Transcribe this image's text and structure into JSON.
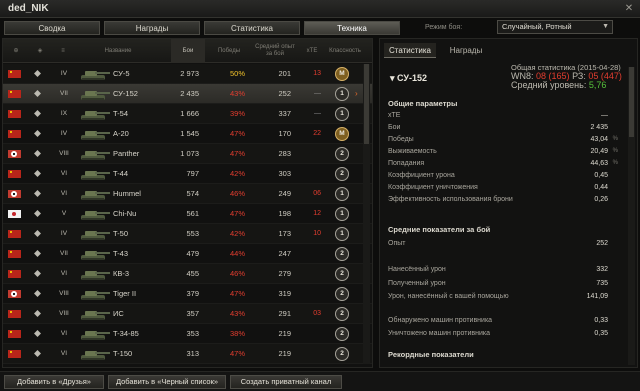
{
  "window": {
    "title": "ded_NIK",
    "close_glyph": "✕"
  },
  "tabs": [
    "Сводка",
    "Награды",
    "Статистика",
    "Техника"
  ],
  "active_tab": "Техника",
  "mode": {
    "label": "Режим боя:",
    "value": "Случайный, Ротный"
  },
  "table": {
    "headers": {
      "name": "Название",
      "battles": "Бои",
      "wins": "Победы",
      "avg_xp": "Средний опыт за бой",
      "xte": "xTE",
      "mastery": "Классность"
    },
    "rows": [
      {
        "nation": "ussr",
        "class": "light",
        "tier": "IV",
        "name": "СУ-5",
        "battles": "2 973",
        "winrate": "50%",
        "wr_color": "#f2c22a",
        "avg_xp": "201",
        "xte": "13",
        "xte_color": "#e33d2f",
        "mastery": "M",
        "gold": true
      },
      {
        "nation": "ussr",
        "class": "spg",
        "tier": "VII",
        "name": "СУ-152",
        "battles": "2 435",
        "winrate": "43%",
        "wr_color": "#e33d2f",
        "avg_xp": "252",
        "xte": "—",
        "xte_color": "#888",
        "mastery": "1",
        "gold": false,
        "selected": true
      },
      {
        "nation": "ussr",
        "class": "medium",
        "tier": "IX",
        "name": "T-54",
        "battles": "1 666",
        "winrate": "39%",
        "wr_color": "#e33d2f",
        "avg_xp": "337",
        "xte": "—",
        "xte_color": "#888",
        "mastery": "1",
        "gold": false
      },
      {
        "nation": "ussr",
        "class": "medium",
        "tier": "IV",
        "name": "A-20",
        "battles": "1 545",
        "winrate": "47%",
        "wr_color": "#e33d2f",
        "avg_xp": "170",
        "xte": "22",
        "xte_color": "#e33d2f",
        "mastery": "M",
        "gold": true
      },
      {
        "nation": "germany",
        "class": "medium",
        "tier": "VIII",
        "name": "Panther",
        "battles": "1 073",
        "winrate": "47%",
        "wr_color": "#e33d2f",
        "avg_xp": "283",
        "xte": "",
        "xte_color": "#888",
        "mastery": "2",
        "gold": false
      },
      {
        "nation": "ussr",
        "class": "medium",
        "tier": "VI",
        "name": "T-44",
        "battles": "797",
        "winrate": "42%",
        "wr_color": "#e33d2f",
        "avg_xp": "303",
        "xte": "",
        "xte_color": "#888",
        "mastery": "2",
        "gold": false
      },
      {
        "nation": "germany",
        "class": "spg",
        "tier": "VI",
        "name": "Hummel",
        "battles": "574",
        "winrate": "46%",
        "wr_color": "#e33d2f",
        "avg_xp": "249",
        "xte": "06",
        "xte_color": "#e33d2f",
        "mastery": "1",
        "gold": false
      },
      {
        "nation": "japan",
        "class": "medium",
        "tier": "V",
        "name": "Chi-Nu",
        "battles": "561",
        "winrate": "47%",
        "wr_color": "#e33d2f",
        "avg_xp": "198",
        "xte": "12",
        "xte_color": "#e33d2f",
        "mastery": "1",
        "gold": false
      },
      {
        "nation": "ussr",
        "class": "light",
        "tier": "IV",
        "name": "T-50",
        "battles": "553",
        "winrate": "42%",
        "wr_color": "#e33d2f",
        "avg_xp": "173",
        "xte": "10",
        "xte_color": "#e33d2f",
        "mastery": "1",
        "gold": false
      },
      {
        "nation": "ussr",
        "class": "medium",
        "tier": "VII",
        "name": "T-43",
        "battles": "479",
        "winrate": "44%",
        "wr_color": "#e33d2f",
        "avg_xp": "247",
        "xte": "",
        "xte_color": "#888",
        "mastery": "2",
        "gold": false
      },
      {
        "nation": "ussr",
        "class": "heavy",
        "tier": "VI",
        "name": "КВ-3",
        "battles": "455",
        "winrate": "46%",
        "wr_color": "#e33d2f",
        "avg_xp": "279",
        "xte": "",
        "xte_color": "#888",
        "mastery": "2",
        "gold": false
      },
      {
        "nation": "germany",
        "class": "heavy",
        "tier": "VIII",
        "name": "Tiger II",
        "battles": "379",
        "winrate": "47%",
        "wr_color": "#e33d2f",
        "avg_xp": "319",
        "xte": "",
        "xte_color": "#888",
        "mastery": "2",
        "gold": false
      },
      {
        "nation": "ussr",
        "class": "heavy",
        "tier": "VIII",
        "name": "ИС",
        "battles": "357",
        "winrate": "43%",
        "wr_color": "#e33d2f",
        "avg_xp": "291",
        "xte": "03",
        "xte_color": "#e33d2f",
        "mastery": "2",
        "gold": false
      },
      {
        "nation": "ussr",
        "class": "medium",
        "tier": "VI",
        "name": "T-34-85",
        "battles": "353",
        "winrate": "38%",
        "wr_color": "#e33d2f",
        "avg_xp": "219",
        "xte": "",
        "xte_color": "#888",
        "mastery": "2",
        "gold": false
      },
      {
        "nation": "ussr",
        "class": "heavy",
        "tier": "VI",
        "name": "T-150",
        "battles": "313",
        "winrate": "47%",
        "wr_color": "#e33d2f",
        "avg_xp": "219",
        "xte": "",
        "xte_color": "#888",
        "mastery": "2",
        "gold": false
      }
    ]
  },
  "details": {
    "tabs": [
      "Статистика",
      "Награды"
    ],
    "tank": "СУ-152",
    "summary": {
      "line1": "Общая статистика (2015-04-28)",
      "wn8_label": "WN8:",
      "wn8": "08",
      "wn8_sub": "(165)",
      "rz_label": "РЗ:",
      "rz": "05",
      "rz_sub": "(447)",
      "avg_level_label": "Средний уровень:",
      "avg_level": "5,76"
    },
    "general_title": "Общие параметры",
    "general": [
      {
        "label": "xTE",
        "value": "—",
        "pct": ""
      },
      {
        "label": "Бои",
        "value": "2 435",
        "pct": ""
      },
      {
        "label": "Победы",
        "value": "43,04",
        "pct": "%"
      },
      {
        "label": "Выживаемость",
        "value": "20,49",
        "pct": "%"
      },
      {
        "label": "Попадания",
        "value": "44,63",
        "pct": "%"
      },
      {
        "label": "Коэффициент урона",
        "value": "0,45",
        "pct": ""
      },
      {
        "label": "Коэффициент уничтожения",
        "value": "0,44",
        "pct": ""
      },
      {
        "label": "Эффективность использования брони",
        "value": "0,26",
        "pct": ""
      }
    ],
    "avg_title": "Средние показатели за бой",
    "avg": [
      {
        "label": "Опыт",
        "value": "252"
      },
      {
        "label": "Нанесённый урон",
        "value": "332"
      },
      {
        "label": "Полученный урон",
        "value": "735"
      },
      {
        "label": "Урон, нанесённый с вашей помощью",
        "value": "141,09"
      },
      {
        "label": "Обнаружено машин противника",
        "value": "0,33"
      },
      {
        "label": "Уничтожено машин противника",
        "value": "0,35"
      }
    ],
    "records_title": "Рекордные показатели"
  },
  "bottom": [
    "Добавить в «Друзья»",
    "Добавить в «Черный список»",
    "Создать приватный канал"
  ]
}
